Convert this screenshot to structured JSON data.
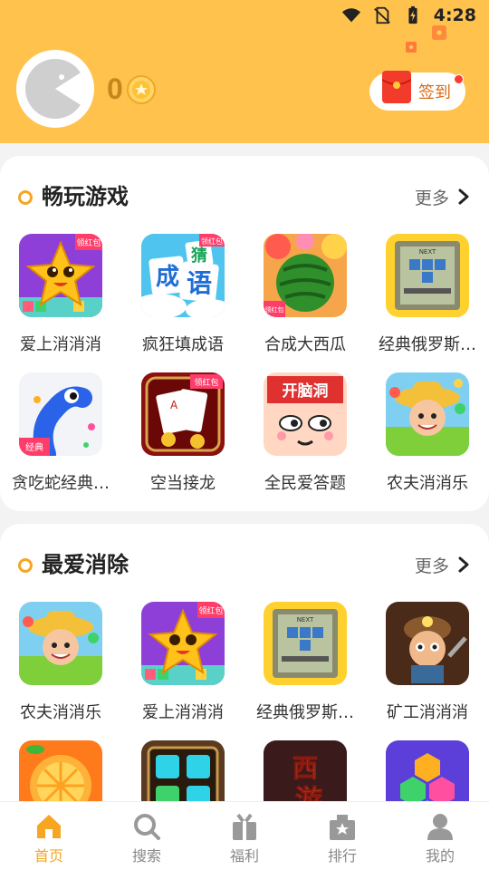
{
  "status": {
    "time": "4:28"
  },
  "profile": {
    "coins": "0"
  },
  "signin": {
    "label": "签到"
  },
  "sections": [
    {
      "title": "畅玩游戏",
      "more": "更多",
      "games": [
        {
          "name": "爱上消消消",
          "icon": "star-game-icon",
          "badge": "领红包"
        },
        {
          "name": "疯狂填成语",
          "icon": "idiom-game-icon",
          "badge": "领红包",
          "icon_text": [
            "猜",
            "成",
            "语"
          ]
        },
        {
          "name": "合成大西瓜",
          "icon": "watermelon-game-icon",
          "badge": "领红包"
        },
        {
          "name": "经典俄罗斯…",
          "icon": "tetris-game-icon",
          "icon_text": "NEXT"
        },
        {
          "name": "贪吃蛇经典…",
          "icon": "snake-game-icon",
          "badge": "经典"
        },
        {
          "name": "空当接龙",
          "icon": "solitaire-game-icon",
          "badge": "领红包"
        },
        {
          "name": "全民爱答题",
          "icon": "quiz-game-icon",
          "icon_text": "开脑洞"
        },
        {
          "name": "农夫消消乐",
          "icon": "farmer-game-icon"
        }
      ]
    },
    {
      "title": "最爱消除",
      "more": "更多",
      "games": [
        {
          "name": "农夫消消乐",
          "icon": "farmer-game-icon"
        },
        {
          "name": "爱上消消消",
          "icon": "star-game-icon",
          "badge": "领红包"
        },
        {
          "name": "经典俄罗斯…",
          "icon": "tetris-game-icon",
          "icon_text": "NEXT"
        },
        {
          "name": "矿工消消消",
          "icon": "miner-game-icon"
        },
        {
          "name": "",
          "icon": "orange-game-icon"
        },
        {
          "name": "",
          "icon": "gem-game-icon"
        },
        {
          "name": "",
          "icon": "journey-game-icon",
          "icon_text": "西游"
        },
        {
          "name": "",
          "icon": "hexagon-game-icon"
        }
      ]
    }
  ],
  "nav": [
    {
      "label": "首页",
      "icon": "home-icon",
      "active": true
    },
    {
      "label": "搜索",
      "icon": "search-icon"
    },
    {
      "label": "福利",
      "icon": "gift-icon"
    },
    {
      "label": "排行",
      "icon": "ranking-icon"
    },
    {
      "label": "我的",
      "icon": "profile-icon"
    }
  ],
  "colors": {
    "header": "#ffc34d",
    "accent": "#f6a623",
    "signin_text": "#d96a15"
  }
}
